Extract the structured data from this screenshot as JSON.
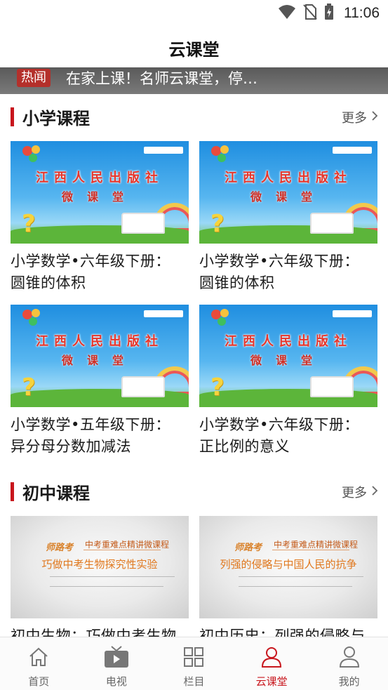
{
  "status_bar": {
    "time": "11:06",
    "icons": [
      "wifi-icon",
      "no-sim-icon",
      "battery-charging-icon"
    ]
  },
  "header": {
    "title": "云课堂"
  },
  "hot_news": {
    "tag": "热闻",
    "text": "在家上课！名师云课堂，停…"
  },
  "sections": [
    {
      "title": "小学课程",
      "more_label": "更多",
      "cards": [
        {
          "title_line1": "小学数学•六年级下册：",
          "title_line2": "圆锥的体积",
          "thumb_title": "江西人民出版社",
          "thumb_sub": "微课堂"
        },
        {
          "title_line1": "小学数学•六年级下册：",
          "title_line2": "圆锥的体积",
          "thumb_title": "江西人民出版社",
          "thumb_sub": "微课堂"
        },
        {
          "title_line1": "小学数学•五年级下册：",
          "title_line2": "异分母分数加减法",
          "thumb_title": "江西人民出版社",
          "thumb_sub": "微课堂"
        },
        {
          "title_line1": "小学数学•六年级下册：",
          "title_line2": "正比例的意义",
          "thumb_title": "江西人民出版社",
          "thumb_sub": "微课堂"
        }
      ]
    },
    {
      "title": "初中课程",
      "more_label": "更多",
      "cards": [
        {
          "title_line1": "初中生物：巧做中考生物",
          "thumb_logo": "师路考",
          "thumb_series": "中考重难点精讲微课程",
          "thumb_topic": "巧做中考生物探究性实验"
        },
        {
          "title_line1": "初中历史：列强的侵略与",
          "thumb_logo": "师路考",
          "thumb_series": "中考重难点精讲微课程",
          "thumb_topic": "列强的侵略与中国人民的抗争"
        }
      ]
    }
  ],
  "bottom_nav": {
    "items": [
      {
        "label": "首页",
        "icon": "home-icon"
      },
      {
        "label": "电视",
        "icon": "tv-icon"
      },
      {
        "label": "栏目",
        "icon": "grid-icon"
      },
      {
        "label": "云课堂",
        "icon": "user-outline-icon"
      },
      {
        "label": "我的",
        "icon": "profile-icon"
      }
    ],
    "active_index": 3
  },
  "colors": {
    "accent": "#c8161d",
    "hot_bar_bg": "#6b6b6b",
    "hot_tag_bg": "#b4302b"
  }
}
